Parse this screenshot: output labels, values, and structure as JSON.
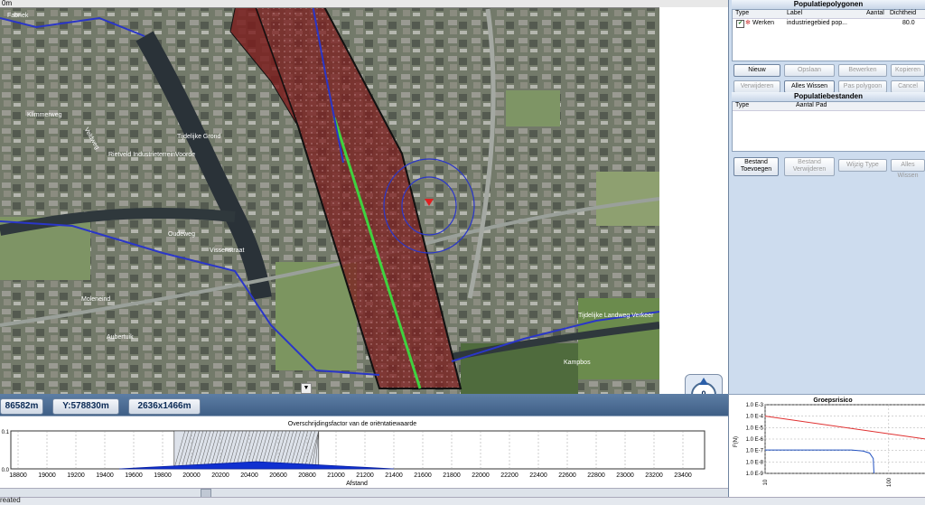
{
  "map": {
    "ruler_label": "0m",
    "street_labels": [
      "Fabriek",
      "Klimmerweg",
      "Veldweg",
      "Tijdelijke Grond",
      "Rietveld IndustrieterreinVoorde",
      "Oudeweg",
      "Vissenstraat",
      "Moleneind",
      "Aubertuik",
      "Kampbos",
      "Tijdelijke Landweg Verkeer"
    ],
    "compass_value": "0"
  },
  "status": {
    "x_coord": "86582m",
    "y_coord": "Y:578830m",
    "size": "2636x1466m"
  },
  "exceedance_chart": {
    "title": "Overschrijdingsfactor van de oriëntatiewaarde",
    "xlabel": "Afstand"
  },
  "chart_data": [
    {
      "type": "area",
      "title": "Overschrijdingsfactor van de oriëntatiewaarde",
      "xlabel": "Afstand",
      "ylabel": "",
      "x_ticks": [
        "18800",
        "19000",
        "19200",
        "19400",
        "19600",
        "19800",
        "20000",
        "20200",
        "20400",
        "20600",
        "20800",
        "21000",
        "21200",
        "21400",
        "21600",
        "21800",
        "22000",
        "22200",
        "22400",
        "22600",
        "22800",
        "23000",
        "23200",
        "23400"
      ],
      "y_ticks": [
        "0.1",
        "0.0"
      ],
      "xlim": [
        18750,
        23550
      ],
      "ylim": [
        0,
        0.1
      ],
      "x": [
        19500,
        19700,
        19900,
        20100,
        20300,
        20450,
        20600,
        20800,
        21000,
        21200,
        21400
      ],
      "y": [
        0.0,
        0.004,
        0.008,
        0.012,
        0.016,
        0.019,
        0.016,
        0.012,
        0.008,
        0.004,
        0.0
      ],
      "hatched_range": [
        19880,
        20880
      ]
    },
    {
      "type": "line",
      "title": "Groepsrisico",
      "xlabel": "",
      "ylabel": "F(N)",
      "x_ticks": [
        "10",
        "100"
      ],
      "y_ticks": [
        "1.0 E-3",
        "1.0 E-4",
        "1.0 E-5",
        "1.0 E-6",
        "1.0 E-7",
        "1.0 E-8",
        "1.0 E-9"
      ],
      "xscale": "log",
      "yscale": "log",
      "xlim": [
        10,
        200
      ],
      "ylim": [
        1e-09,
        0.001
      ],
      "series": [
        {
          "x": [
            10,
            200
          ],
          "y": [
            0.0001,
            1e-06
          ],
          "color": "#e03030"
        },
        {
          "x": [
            10,
            50,
            62,
            70,
            75,
            76
          ],
          "y": [
            1.1e-07,
            1.1e-07,
            9e-08,
            6e-08,
            2e-08,
            1e-09
          ],
          "color": "#2050c0"
        }
      ]
    }
  ],
  "populatiepolygonen": {
    "header": "Populatiepolygonen",
    "columns": [
      "Type",
      "Label",
      "Aantal",
      "Dichtheid"
    ],
    "rows": [
      {
        "type": "Werken",
        "label": "industriegebied pop...",
        "aantal": "",
        "dichtheid": "80.0",
        "checked": true
      }
    ],
    "buttons": [
      "Nieuw",
      "Opslaan",
      "Bewerken",
      "Kopieren",
      "Verwijderen",
      "Alles Wissen",
      "Pas polygoon aan",
      "Cancel"
    ]
  },
  "populatiebestanden": {
    "header": "Populatiebestanden",
    "columns": [
      "Type",
      "Aantal",
      "Pad"
    ],
    "buttons": [
      {
        "line1": "Bestand",
        "line2": "Toevoegen",
        "enabled": true
      },
      {
        "line1": "Bestand",
        "line2": "Verwijderen",
        "enabled": false
      },
      {
        "line1": "Wijzig Type",
        "line2": "",
        "enabled": false
      },
      {
        "line1": "Alles Wissen",
        "line2": "",
        "enabled": false
      }
    ]
  },
  "groepsrisico": {
    "title": "Groepsrisico",
    "ylabel": "F(N)"
  },
  "statusline": "reated",
  "colors": {
    "zone_fill": "#7a1a1a",
    "pipeline": "#3fd23f",
    "contour": "#2a36c8",
    "panel_bg": "#cddcee",
    "statusbar": "#4a6b92"
  }
}
